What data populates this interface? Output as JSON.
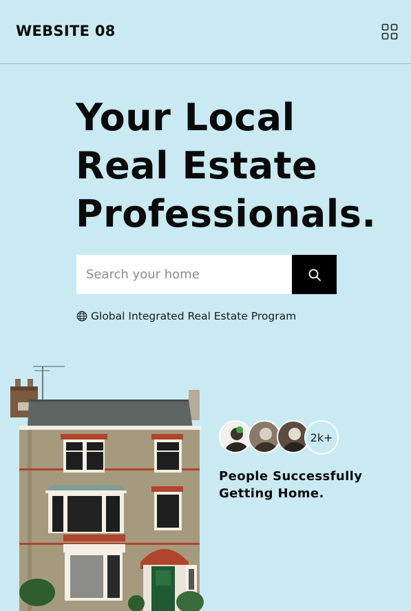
{
  "header": {
    "logo": "WEBSITE 08",
    "menu_icon": "grid-icon"
  },
  "hero": {
    "title_line1": "Your Local",
    "title_line2": "Real Estate",
    "title_line3": "Professionals."
  },
  "search": {
    "placeholder": "Search your home",
    "value": "",
    "button_icon": "search-icon"
  },
  "program": {
    "icon": "globe-icon",
    "text": "Global Integrated Real Estate Program"
  },
  "stats": {
    "count": "2k+",
    "text_line1": "People Successfully",
    "text_line2": "Getting Home."
  },
  "colors": {
    "background": "#c9eaf2",
    "search_button": "#000000",
    "brick_accent": "#b0442c"
  }
}
